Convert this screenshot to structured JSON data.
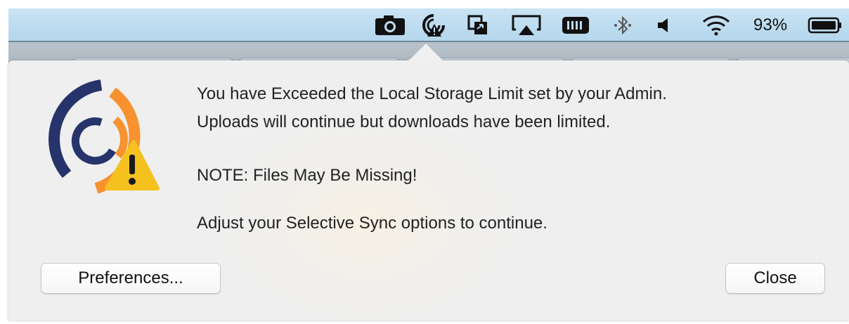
{
  "menubar": {
    "icons": [
      "camera-icon",
      "sync-app-icon",
      "screen-share-icon",
      "airplay-icon",
      "memory-icon",
      "bluetooth-icon",
      "volume-icon",
      "wifi-icon",
      "battery-icon"
    ],
    "battery_percent": "93%"
  },
  "dialog": {
    "line1": "You have Exceeded the Local Storage Limit set by your Admin.",
    "line2": "Uploads will continue but downloads have been limited.",
    "note": "NOTE: Files May Be Missing!",
    "instruction": "Adjust your Selective Sync options to continue.",
    "preferences_label": "Preferences...",
    "close_label": "Close"
  },
  "colors": {
    "logo_navy": "#26346b",
    "logo_orange": "#f7922f",
    "warning_yellow": "#f5c11f",
    "menubar_blue": "#bfdcef"
  }
}
